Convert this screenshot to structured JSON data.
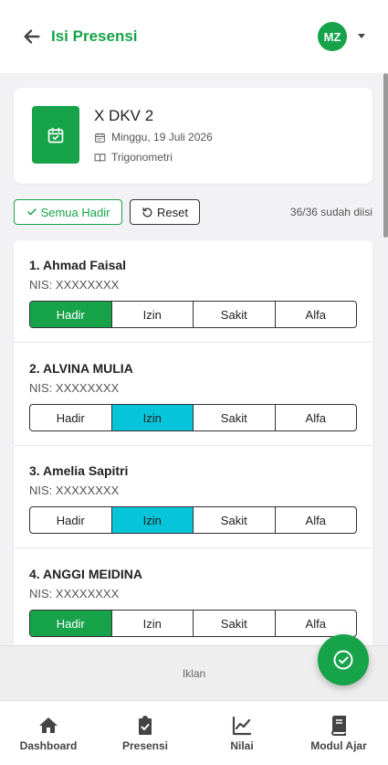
{
  "header": {
    "title": "Isi Presensi",
    "avatar_initials": "MZ"
  },
  "class_info": {
    "name": "X DKV 2",
    "date": "Minggu, 19 Juli 2026",
    "subject": "Trigonometri"
  },
  "actions": {
    "mark_all_label": "Semua Hadir",
    "reset_label": "Reset",
    "filled_status": "36/36 sudah diisi"
  },
  "attendance_options": [
    "Hadir",
    "Izin",
    "Sakit",
    "Alfa"
  ],
  "students": [
    {
      "name": "1. Ahmad Faisal",
      "nis": "NIS: XXXXXXXX",
      "status": "Hadir"
    },
    {
      "name": "2. ALVINA MULIA",
      "nis": "NIS: XXXXXXXX",
      "status": "Izin"
    },
    {
      "name": "3. Amelia Sapitri",
      "nis": "NIS: XXXXXXXX",
      "status": "Izin"
    },
    {
      "name": "4. ANGGI MEIDINA",
      "nis": "NIS: XXXXXXXX",
      "status": "Hadir"
    }
  ],
  "ad": {
    "label": "Iklan"
  },
  "bottom_nav": [
    {
      "label": "Dashboard",
      "icon": "home-icon"
    },
    {
      "label": "Presensi",
      "icon": "clipboard-check-icon"
    },
    {
      "label": "Nilai",
      "icon": "chart-line-icon"
    },
    {
      "label": "Modul Ajar",
      "icon": "book-icon"
    }
  ],
  "colors": {
    "primary": "#16a34a",
    "izin": "#06c4da",
    "background": "#f2f2f4"
  }
}
